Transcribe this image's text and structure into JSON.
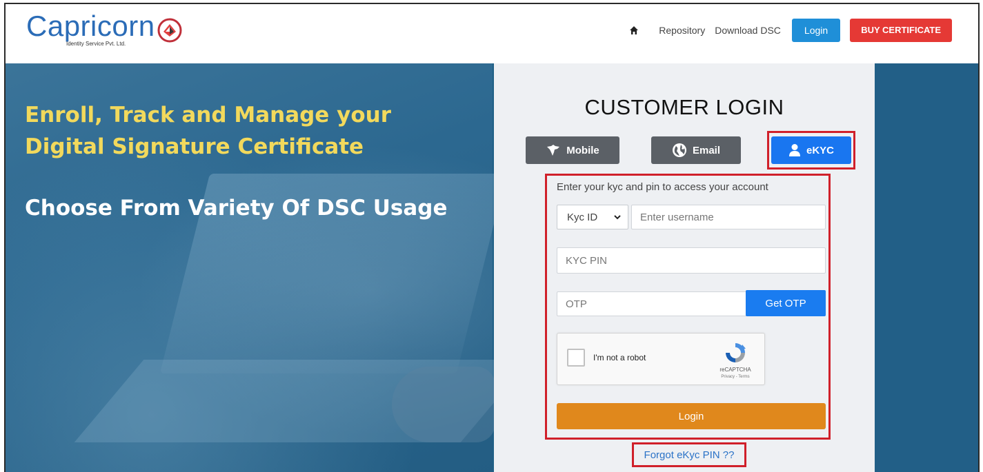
{
  "header": {
    "logo_text": "Capricorn",
    "logo_subtitle": "Identity Service Pvt. Ltd.",
    "nav": {
      "home_icon": "home-icon",
      "repository": "Repository",
      "download_dsc": "Download DSC",
      "login": "Login",
      "buy_certificate": "BUY CERTIFICATE"
    }
  },
  "hero": {
    "headline": "Enroll, Track and Manage your Digital Signature Certificate",
    "subheadline": "Choose From Variety Of DSC Usage"
  },
  "login_panel": {
    "title": "CUSTOMER LOGIN",
    "tabs": [
      {
        "label": "Mobile",
        "icon": "india-map-icon",
        "active": false
      },
      {
        "label": "Email",
        "icon": "globe-icon",
        "active": false
      },
      {
        "label": "eKYC",
        "icon": "user-icon",
        "active": true
      }
    ],
    "hint": "Enter your kyc and pin to access your account",
    "id_type_selected": "Kyc ID",
    "username_placeholder": "Enter username",
    "pin_placeholder": "KYC PIN",
    "otp_placeholder": "OTP",
    "get_otp": "Get OTP",
    "captcha": {
      "label": "I'm not a robot",
      "brand": "reCAPTCHA",
      "terms": "Privacy - Terms"
    },
    "login_button": "Login",
    "forgot_link": "Forgot eKyc PIN ??"
  },
  "colors": {
    "brand_blue": "#2b6cb7",
    "nav_login": "#1f8fd8",
    "buy": "#e53935",
    "hero_bg": "#1f5f85",
    "headline": "#f2d95c",
    "active_tab": "#1976f0",
    "tab": "#5b6066",
    "login_btn": "#e0881c",
    "highlight": "#d0202a"
  }
}
